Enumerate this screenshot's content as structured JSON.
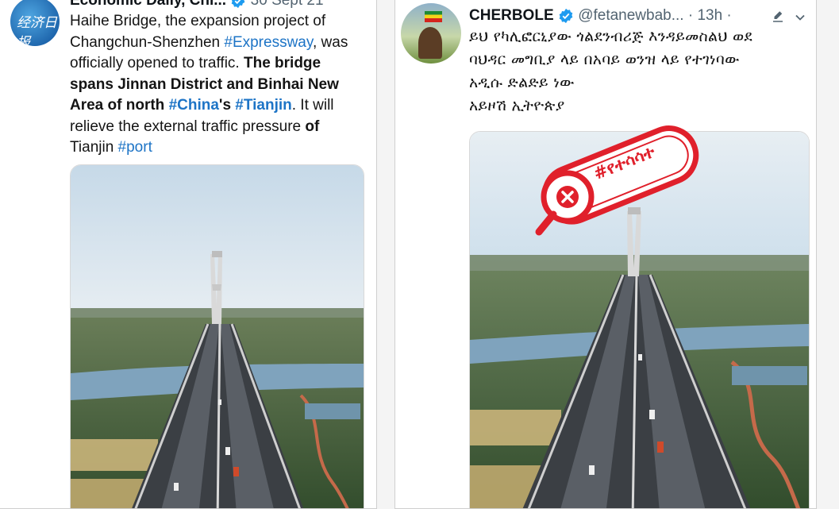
{
  "left_tweet": {
    "author_name": "Economic Daily, Chi...",
    "date": "30 Sept 21",
    "lines": [
      [
        {
          "t": "Haihe Bridge, the expansion project of"
        }
      ],
      [
        {
          "t": "Changchun-Shenzhen "
        },
        {
          "t": "#Expressway",
          "tag": true
        },
        {
          "t": ", was"
        }
      ],
      [
        {
          "t": "officially opened to traffic. "
        },
        {
          "t": "The bridge",
          "b": true
        }
      ],
      [
        {
          "t": "spans Jinnan District and Binhai New",
          "b": true
        }
      ],
      [
        {
          "t": "Area of north ",
          "b": true
        },
        {
          "t": "#China",
          "tag": true,
          "b": true
        },
        {
          "t": "'s ",
          "b": true
        },
        {
          "t": "#Tianjin",
          "tag": true,
          "b": true
        },
        {
          "t": ". It will"
        }
      ],
      [
        {
          "t": "relieve the external traffic pressure "
        },
        {
          "t": "of",
          "b": true
        }
      ],
      [
        {
          "t": "Tianjin "
        },
        {
          "t": "#port",
          "tag": true
        }
      ]
    ]
  },
  "right_tweet": {
    "author_name": "CHERBOLE",
    "handle": "@fetanewbab...",
    "time": "· 13h ·",
    "lines": [
      "ይህ የካሊፎርኒያው ጎልደንብሪጅ እንዳይመስልህ ወደ",
      "ባህዳር መግቢያ ላይ በአባይ ወንዝ ላይ የተገነባው",
      "አዲሱ ድልድይ ነው",
      "አይዞሽ ኢትዮጵያ"
    ],
    "stamp_text": "#የተሳሳተ"
  },
  "colors": {
    "link": "#1d74c6",
    "verified": "#1d9bf0",
    "stamp_red": "#e0202b",
    "river": "#7fa3bd",
    "sky": "#cfe0ec"
  }
}
